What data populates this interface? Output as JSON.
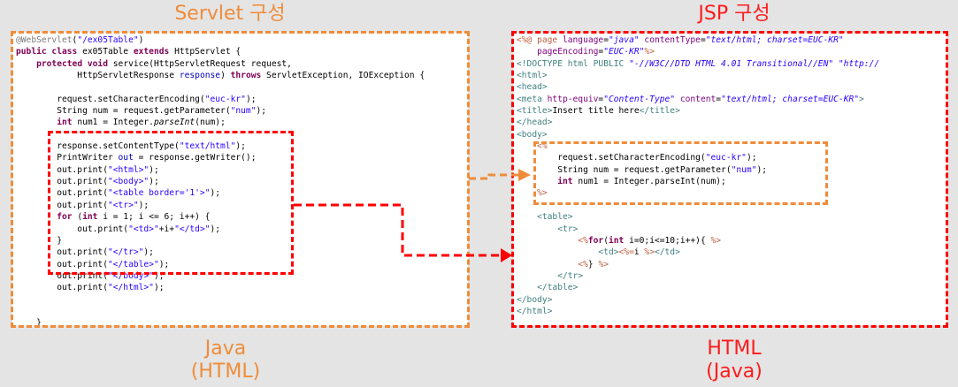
{
  "titles": {
    "servlet": "Servlet 구성",
    "jsp": "JSP 구성",
    "java_line1": "Java",
    "java_line2": "(HTML)",
    "html_line1": "HTML",
    "html_line2": "(Java)"
  },
  "colors": {
    "orange": "#ef8c3a",
    "red": "#ff0000",
    "background": "#e4e4e4"
  },
  "servlet_code": [
    [
      {
        "t": "@WebServlet",
        "c": "ann"
      },
      {
        "t": "(",
        "c": ""
      },
      {
        "t": "\"/ex05Table\"",
        "c": "str"
      },
      {
        "t": ")",
        "c": ""
      }
    ],
    [
      {
        "t": "public class",
        "c": "kw"
      },
      {
        "t": " ex05Table ",
        "c": ""
      },
      {
        "t": "extends",
        "c": "kw"
      },
      {
        "t": " HttpServlet {",
        "c": ""
      }
    ],
    [
      {
        "t": "    ",
        "c": ""
      },
      {
        "t": "protected void",
        "c": "kw"
      },
      {
        "t": " service(HttpServletRequest request,",
        "c": ""
      }
    ],
    [
      {
        "t": "            HttpServletResponse ",
        "c": ""
      },
      {
        "t": "response",
        "c": "fld"
      },
      {
        "t": ") ",
        "c": ""
      },
      {
        "t": "throws",
        "c": "kw"
      },
      {
        "t": " ServletException, IOException {",
        "c": ""
      }
    ],
    [
      {
        "t": "",
        "c": ""
      }
    ],
    [
      {
        "t": "        request.setCharacterEncoding(",
        "c": ""
      },
      {
        "t": "\"euc-kr\"",
        "c": "str"
      },
      {
        "t": ");",
        "c": ""
      }
    ],
    [
      {
        "t": "        String num = request.getParameter(",
        "c": ""
      },
      {
        "t": "\"num\"",
        "c": "str"
      },
      {
        "t": ");",
        "c": ""
      }
    ],
    [
      {
        "t": "        ",
        "c": ""
      },
      {
        "t": "int",
        "c": "kw"
      },
      {
        "t": " num1 = Integer.",
        "c": ""
      },
      {
        "t": "parseInt",
        "c": "it"
      },
      {
        "t": "(num);",
        "c": ""
      }
    ],
    [
      {
        "t": "",
        "c": ""
      }
    ],
    [
      {
        "t": "        response.setContentType(",
        "c": ""
      },
      {
        "t": "\"text/html\"",
        "c": "str"
      },
      {
        "t": ");",
        "c": ""
      }
    ],
    [
      {
        "t": "        PrintWriter ",
        "c": ""
      },
      {
        "t": "out",
        "c": "fld"
      },
      {
        "t": " = response.getWriter();",
        "c": ""
      }
    ],
    [
      {
        "t": "        out.print(",
        "c": ""
      },
      {
        "t": "\"<html>\"",
        "c": "str"
      },
      {
        "t": ");",
        "c": ""
      }
    ],
    [
      {
        "t": "        out.print(",
        "c": ""
      },
      {
        "t": "\"<body>\"",
        "c": "str"
      },
      {
        "t": ");",
        "c": ""
      }
    ],
    [
      {
        "t": "        out.print(",
        "c": ""
      },
      {
        "t": "\"<table border='1'>\"",
        "c": "str"
      },
      {
        "t": ");",
        "c": ""
      }
    ],
    [
      {
        "t": "        out.print(",
        "c": ""
      },
      {
        "t": "\"<tr>\"",
        "c": "str"
      },
      {
        "t": ");",
        "c": ""
      }
    ],
    [
      {
        "t": "        ",
        "c": ""
      },
      {
        "t": "for",
        "c": "kw"
      },
      {
        "t": " (",
        "c": ""
      },
      {
        "t": "int",
        "c": "kw"
      },
      {
        "t": " i = 1; i <= 6; i++) {",
        "c": ""
      }
    ],
    [
      {
        "t": "            out.print(",
        "c": ""
      },
      {
        "t": "\"<td>\"",
        "c": "str"
      },
      {
        "t": "+i+",
        "c": ""
      },
      {
        "t": "\"</td>\"",
        "c": "str"
      },
      {
        "t": ");",
        "c": ""
      }
    ],
    [
      {
        "t": "        }",
        "c": ""
      }
    ],
    [
      {
        "t": "        out.print(",
        "c": ""
      },
      {
        "t": "\"</tr>\"",
        "c": "str"
      },
      {
        "t": ");",
        "c": ""
      }
    ],
    [
      {
        "t": "        out.print(",
        "c": ""
      },
      {
        "t": "\"</table>\"",
        "c": "str"
      },
      {
        "t": ");",
        "c": ""
      }
    ],
    [
      {
        "t": "        out.print(",
        "c": ""
      },
      {
        "t": "\"</body>\"",
        "c": "str"
      },
      {
        "t": ");",
        "c": ""
      }
    ],
    [
      {
        "t": "        out.print(",
        "c": ""
      },
      {
        "t": "\"</html>\"",
        "c": "str"
      },
      {
        "t": ");",
        "c": ""
      }
    ],
    [
      {
        "t": "",
        "c": ""
      }
    ],
    [
      {
        "t": "",
        "c": ""
      }
    ],
    [
      {
        "t": "    }",
        "c": ""
      }
    ],
    [
      {
        "t": "",
        "c": ""
      }
    ],
    [
      {
        "t": "}",
        "c": ""
      }
    ]
  ],
  "jsp_code": [
    [
      {
        "t": "<%@ page ",
        "c": "jsp"
      },
      {
        "t": "language",
        "c": "attr"
      },
      {
        "t": "=",
        "c": ""
      },
      {
        "t": "\"java\"",
        "c": "aval"
      },
      {
        "t": " contentType",
        "c": "attr"
      },
      {
        "t": "=",
        "c": ""
      },
      {
        "t": "\"text/html; charset=EUC-KR\"",
        "c": "aval"
      }
    ],
    [
      {
        "t": "    pageEncoding",
        "c": "attr"
      },
      {
        "t": "=",
        "c": ""
      },
      {
        "t": "\"EUC-KR\"",
        "c": "aval"
      },
      {
        "t": "%>",
        "c": "jsp"
      }
    ],
    [
      {
        "t": "<!DOCTYPE html PUBLIC ",
        "c": "tag"
      },
      {
        "t": "\"-//W3C//DTD HTML 4.01 Transitional//EN\"",
        "c": "aval"
      },
      {
        "t": " \"http://",
        "c": "aval"
      }
    ],
    [
      {
        "t": "<html>",
        "c": "tag"
      }
    ],
    [
      {
        "t": "<head>",
        "c": "tag"
      }
    ],
    [
      {
        "t": "<meta ",
        "c": "tag"
      },
      {
        "t": "http-equiv",
        "c": "attr"
      },
      {
        "t": "=",
        "c": ""
      },
      {
        "t": "\"Content-Type\"",
        "c": "aval"
      },
      {
        "t": " content",
        "c": "attr"
      },
      {
        "t": "=",
        "c": ""
      },
      {
        "t": "\"text/html; charset=EUC-KR\"",
        "c": "aval"
      },
      {
        "t": ">",
        "c": "tag"
      }
    ],
    [
      {
        "t": "<title>",
        "c": "tag"
      },
      {
        "t": "Insert title here",
        "c": ""
      },
      {
        "t": "</title>",
        "c": "tag"
      }
    ],
    [
      {
        "t": "</head>",
        "c": "tag"
      }
    ],
    [
      {
        "t": "<body>",
        "c": "tag"
      }
    ],
    [
      {
        "t": "    <%",
        "c": "jsp"
      }
    ],
    [
      {
        "t": "        request.setCharacterEncoding(",
        "c": ""
      },
      {
        "t": "\"euc-kr\"",
        "c": "str"
      },
      {
        "t": ");",
        "c": ""
      }
    ],
    [
      {
        "t": "        String num = request.getParameter(",
        "c": ""
      },
      {
        "t": "\"num\"",
        "c": "str"
      },
      {
        "t": ");",
        "c": ""
      }
    ],
    [
      {
        "t": "        ",
        "c": ""
      },
      {
        "t": "int",
        "c": "kw"
      },
      {
        "t": " num1 = Integer.parseInt(num);",
        "c": ""
      }
    ],
    [
      {
        "t": "    %>",
        "c": "jsp"
      }
    ],
    [
      {
        "t": "",
        "c": ""
      }
    ],
    [
      {
        "t": "    <table>",
        "c": "tag"
      }
    ],
    [
      {
        "t": "        <tr>",
        "c": "tag"
      }
    ],
    [
      {
        "t": "            <%",
        "c": "jsp"
      },
      {
        "t": "for",
        "c": "kw"
      },
      {
        "t": "(",
        "c": ""
      },
      {
        "t": "int",
        "c": "kw"
      },
      {
        "t": " i=0;i<=10;i++){ ",
        "c": ""
      },
      {
        "t": "%>",
        "c": "jsp"
      }
    ],
    [
      {
        "t": "                <td>",
        "c": "tag"
      },
      {
        "t": "<%=",
        "c": "jsp"
      },
      {
        "t": "i ",
        "c": ""
      },
      {
        "t": "%>",
        "c": "jsp"
      },
      {
        "t": "</td>",
        "c": "tag"
      }
    ],
    [
      {
        "t": "            <%",
        "c": "jsp"
      },
      {
        "t": "} ",
        "c": ""
      },
      {
        "t": "%>",
        "c": "jsp"
      }
    ],
    [
      {
        "t": "        </tr>",
        "c": "tag"
      }
    ],
    [
      {
        "t": "    </table>",
        "c": "tag"
      }
    ],
    [
      {
        "t": "</body>",
        "c": "tag"
      }
    ],
    [
      {
        "t": "</html>",
        "c": "tag"
      }
    ]
  ]
}
